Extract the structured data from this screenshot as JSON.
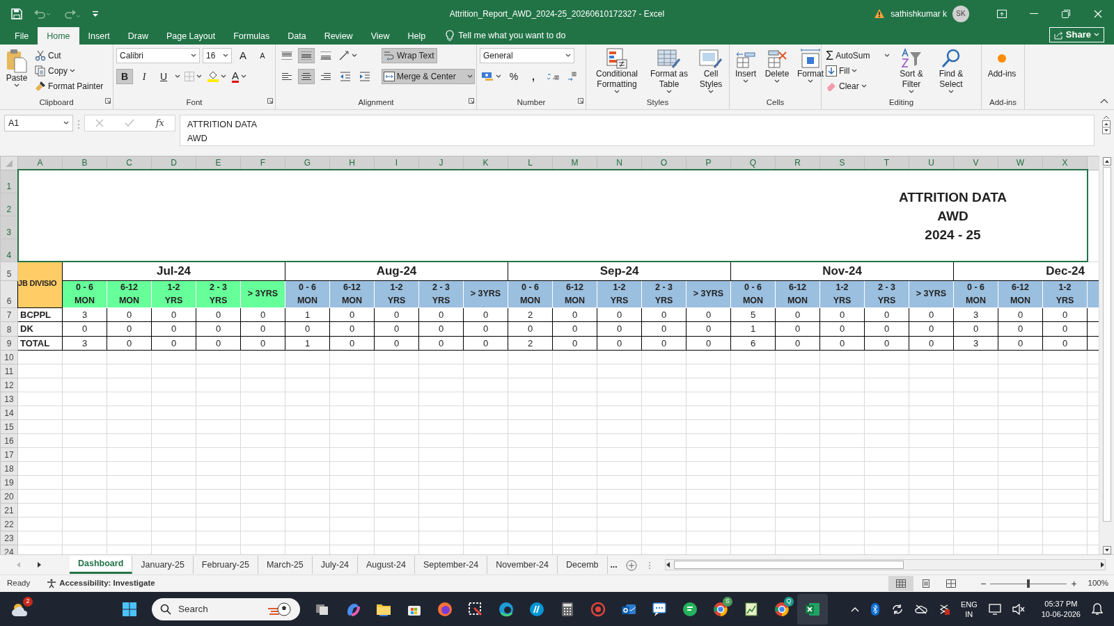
{
  "window": {
    "title": "Attrition_Report_AWD_2024-25_20260610172327  -  Excel",
    "user": "sathishkumar k",
    "avatar": "SK"
  },
  "menu_tabs": [
    {
      "label": "File",
      "selected": false
    },
    {
      "label": "Home",
      "selected": true
    },
    {
      "label": "Insert",
      "selected": false
    },
    {
      "label": "Draw",
      "selected": false
    },
    {
      "label": "Page Layout",
      "selected": false
    },
    {
      "label": "Formulas",
      "selected": false
    },
    {
      "label": "Data",
      "selected": false
    },
    {
      "label": "Review",
      "selected": false
    },
    {
      "label": "View",
      "selected": false
    },
    {
      "label": "Help",
      "selected": false
    }
  ],
  "tell_me": "Tell me what you want to do",
  "share": "Share",
  "ribbon": {
    "clipboard": {
      "label": "Clipboard",
      "paste": "Paste",
      "cut": "Cut",
      "copy": "Copy",
      "format_painter": "Format Painter"
    },
    "font": {
      "label": "Font",
      "name": "Calibri",
      "size": "16",
      "grow": "A",
      "shrink": "A",
      "styles": [
        {
          "label": "B",
          "on": true
        },
        {
          "label": "I",
          "on": false
        },
        {
          "label": "U",
          "on": false
        }
      ],
      "color_letter": "A"
    },
    "alignment": {
      "label": "Alignment",
      "vertical": [
        {
          "selected": false
        },
        {
          "selected": true
        },
        {
          "selected": false
        }
      ],
      "horizontal": [
        {
          "selected": false
        },
        {
          "selected": true
        },
        {
          "selected": false
        }
      ],
      "wrap_text": {
        "label": "Wrap Text",
        "on": true
      },
      "merge": {
        "label": "Merge & Center",
        "on": true
      }
    },
    "number": {
      "label": "Number",
      "format": "General",
      "percent": "%",
      "comma": ","
    },
    "styles": {
      "label": "Styles",
      "buttons": [
        "Conditional Formatting",
        "Format as Table",
        "Cell Styles"
      ]
    },
    "cells": {
      "label": "Cells",
      "buttons": [
        "Insert",
        "Delete",
        "Format"
      ]
    },
    "editing": {
      "label": "Editing",
      "sigma": "Σ",
      "autosum": "AutoSum",
      "fill": "Fill",
      "clear": "Clear",
      "sort": "Sort & Filter",
      "find": "Find & Select"
    },
    "addins": {
      "label": "Add-ins",
      "button": "Add-ins"
    }
  },
  "formula_bar": {
    "name_box": "A1",
    "fx": "fx",
    "content": "ATTRITION DATA\nAWD"
  },
  "sheet": {
    "columns": [
      "A",
      "B",
      "C",
      "D",
      "E",
      "F",
      "G",
      "H",
      "I",
      "J",
      "K",
      "L",
      "M",
      "N",
      "O",
      "P",
      "Q",
      "R",
      "S",
      "T",
      "U",
      "V",
      "W",
      "X"
    ],
    "row_numbers": [
      "1",
      "2",
      "3",
      "4",
      "5",
      "6",
      "7",
      "8",
      "9",
      "10",
      "11",
      "12",
      "13",
      "14",
      "15",
      "16",
      "17",
      "18",
      "19",
      "20",
      "21",
      "22",
      "23",
      "24"
    ],
    "title": "ATTRITION DATA\nAWD\n2024 - 25",
    "division_header": "JB DIVISIO",
    "months": [
      {
        "label": "Jul-24",
        "color": "#66ff99",
        "buckets": [
          "0 - 6\nMON",
          "6-12\nMON",
          "1-2\nYRS",
          "2 - 3\nYRS",
          "> 3YRS"
        ]
      },
      {
        "label": "Aug-24",
        "color": "#9bbfdf",
        "buckets": [
          "0 - 6\nMON",
          "6-12\nMON",
          "1-2\nYRS",
          "2 - 3\nYRS",
          "> 3YRS"
        ]
      },
      {
        "label": "Sep-24",
        "color": "#9bbfdf",
        "buckets": [
          "0 - 6\nMON",
          "6-12\nMON",
          "1-2\nYRS",
          "2 - 3\nYRS",
          "> 3YRS"
        ]
      },
      {
        "label": "Nov-24",
        "color": "#9bbfdf",
        "buckets": [
          "0 - 6\nMON",
          "6-12\nMON",
          "1-2\nYRS",
          "2 - 3\nYRS",
          "> 3YRS"
        ]
      },
      {
        "label": "Dec-24",
        "color": "#9bbfdf",
        "buckets": [
          "0 - 6\nMON",
          "6-12\nMON",
          "1-2\nYRS"
        ]
      }
    ],
    "rows": [
      {
        "cells": [
          "BCPPL",
          "3",
          "0",
          "0",
          "0",
          "0",
          "1",
          "0",
          "0",
          "0",
          "0",
          "2",
          "0",
          "0",
          "0",
          "0",
          "5",
          "0",
          "0",
          "0",
          "0",
          "3",
          "0",
          "0"
        ]
      },
      {
        "cells": [
          "DK",
          "0",
          "0",
          "0",
          "0",
          "0",
          "0",
          "0",
          "0",
          "0",
          "0",
          "0",
          "0",
          "0",
          "0",
          "0",
          "1",
          "0",
          "0",
          "0",
          "0",
          "0",
          "0",
          "0"
        ]
      },
      {
        "cells": [
          "TOTAL",
          "3",
          "0",
          "0",
          "0",
          "0",
          "1",
          "0",
          "0",
          "0",
          "0",
          "2",
          "0",
          "0",
          "0",
          "0",
          "6",
          "0",
          "0",
          "0",
          "0",
          "3",
          "0",
          "0"
        ]
      }
    ]
  },
  "sheet_tabs": [
    {
      "label": "Dashboard",
      "selected": true
    },
    {
      "label": "January-25",
      "selected": false
    },
    {
      "label": "February-25",
      "selected": false
    },
    {
      "label": "March-25",
      "selected": false
    },
    {
      "label": "July-24",
      "selected": false
    },
    {
      "label": "August-24",
      "selected": false
    },
    {
      "label": "September-24",
      "selected": false
    },
    {
      "label": "November-24",
      "selected": false
    },
    {
      "label": "Decemb",
      "selected": false
    }
  ],
  "more_tabs": "...",
  "status_bar": {
    "ready": "Ready",
    "accessibility": "Accessibility: Investigate",
    "views": [
      {
        "kind": "normal",
        "selected": true
      },
      {
        "kind": "page_layout",
        "selected": false
      },
      {
        "kind": "page_break",
        "selected": false
      }
    ],
    "zoom_out": "−",
    "zoom_slider": {
      "level": 0.5
    },
    "zoom_in": "+",
    "zoom": "100%"
  },
  "taskbar": {
    "weather_badge": "2",
    "search": "Search",
    "app_badges": [
      "S",
      "Q"
    ],
    "language": "ENG\nIN",
    "time": "05:37 PM",
    "date": "10-06-2026"
  }
}
